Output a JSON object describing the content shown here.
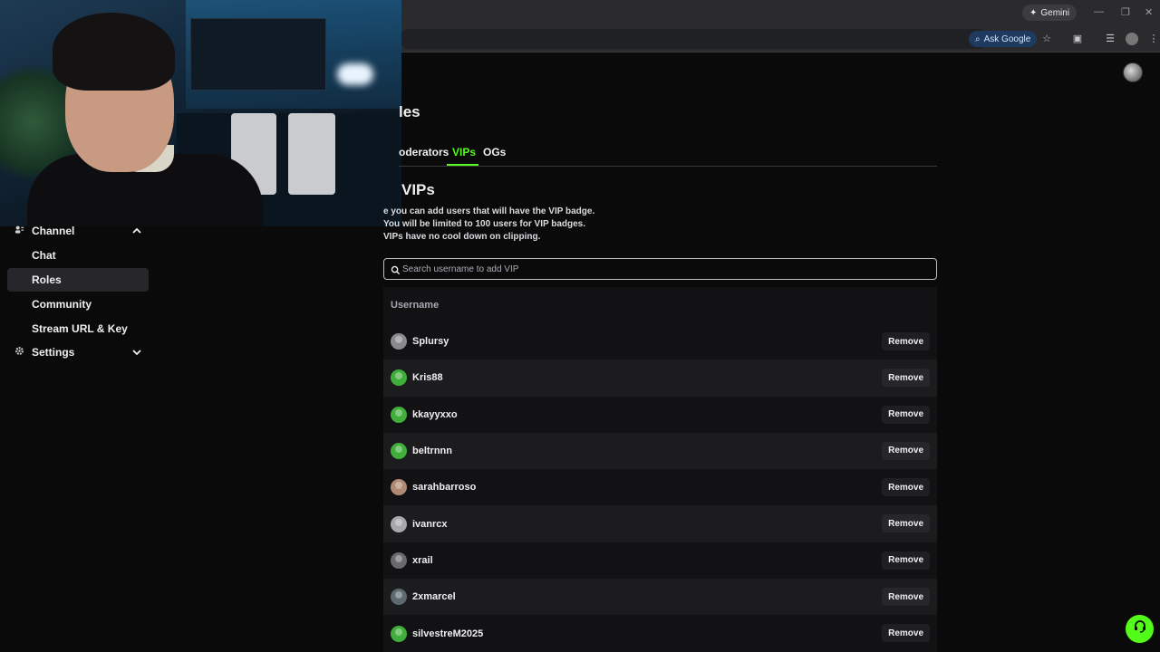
{
  "browser": {
    "gemini_label": "Gemini",
    "ask_google_label": "Ask Google",
    "colors": {
      "chrome_bg": "#2b2b2e"
    }
  },
  "sidebar": {
    "channel": {
      "label": "Channel",
      "icon": "channel-icon"
    },
    "items": [
      {
        "label": "Chat"
      },
      {
        "label": "Roles",
        "active": true
      },
      {
        "label": "Community"
      },
      {
        "label": "Stream URL & Key"
      }
    ],
    "settings": {
      "label": "Settings",
      "icon": "gear-icon"
    }
  },
  "main": {
    "title": "les",
    "tabs": [
      {
        "label": "oderators"
      },
      {
        "label": "VIPs",
        "active": true
      },
      {
        "label": "OGs"
      }
    ],
    "section_title": "VIPs",
    "description": [
      "e you can add users that will have the VIP badge.",
      "You will be limited to 100 users for VIP badges.",
      "VIPs have no cool down on clipping."
    ],
    "search": {
      "placeholder": "Search username to add VIP"
    },
    "table": {
      "header": "Username",
      "remove_label": "Remove",
      "rows": [
        {
          "username": "Splursy",
          "avatar_color": "#8a8a8c"
        },
        {
          "username": "Kris88",
          "avatar_color": "#3fae3a"
        },
        {
          "username": "kkayyxxo",
          "avatar_color": "#3fae3a"
        },
        {
          "username": "beltrnnn",
          "avatar_color": "#3fae3a"
        },
        {
          "username": "sarahbarroso",
          "avatar_color": "#b08a72"
        },
        {
          "username": "ivanrcx",
          "avatar_color": "#a8a8aa"
        },
        {
          "username": "xrail",
          "avatar_color": "#6a6a6c"
        },
        {
          "username": "2xmarcel",
          "avatar_color": "#5c6a70"
        },
        {
          "username": "silvestreM2025",
          "avatar_color": "#3fae3a"
        }
      ]
    }
  },
  "colors": {
    "accent": "#53fc18",
    "background": "#0a0a0b",
    "row_alt": "#1c1c1f"
  }
}
